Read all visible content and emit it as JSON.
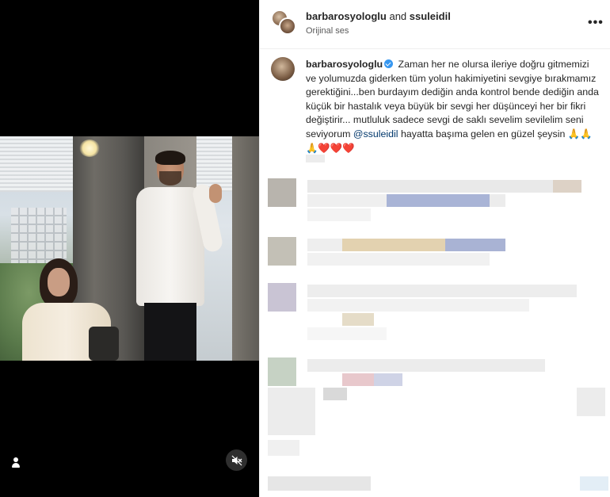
{
  "post": {
    "header": {
      "user1": "barbarosyologlu",
      "joiner": " and ",
      "user2": "ssuleidil",
      "audio_label": "Orijinal ses",
      "more_label": "•••"
    },
    "caption": {
      "username": "barbarosyologlu",
      "text_part1": "Zaman her ne olursa ileriye doğru gitmemizi ve yolumuzda giderken tüm yolun hakimiyetini sevgiye bırakmamız gerektiğini...ben burdayım dediğin anda kontrol bende dediğin anda küçük bir hastalık veya büyük bir sevgi her düşünceyi her bir fikri değiştirir... mutluluk sadece sevgi de saklı sevelim sevilelim seni seviyorum ",
      "mention": "@ssuleidil",
      "text_part2": " hayatta başıma gelen en güzel şeysin ",
      "emojis": "🙏🙏🙏❤️❤️❤️"
    }
  },
  "media": {
    "profile_icon": "user-icon",
    "mute_icon": "muted-speaker-icon"
  },
  "colors": {
    "verified_blue": "#3797f0",
    "mention_blue": "#00376b"
  }
}
